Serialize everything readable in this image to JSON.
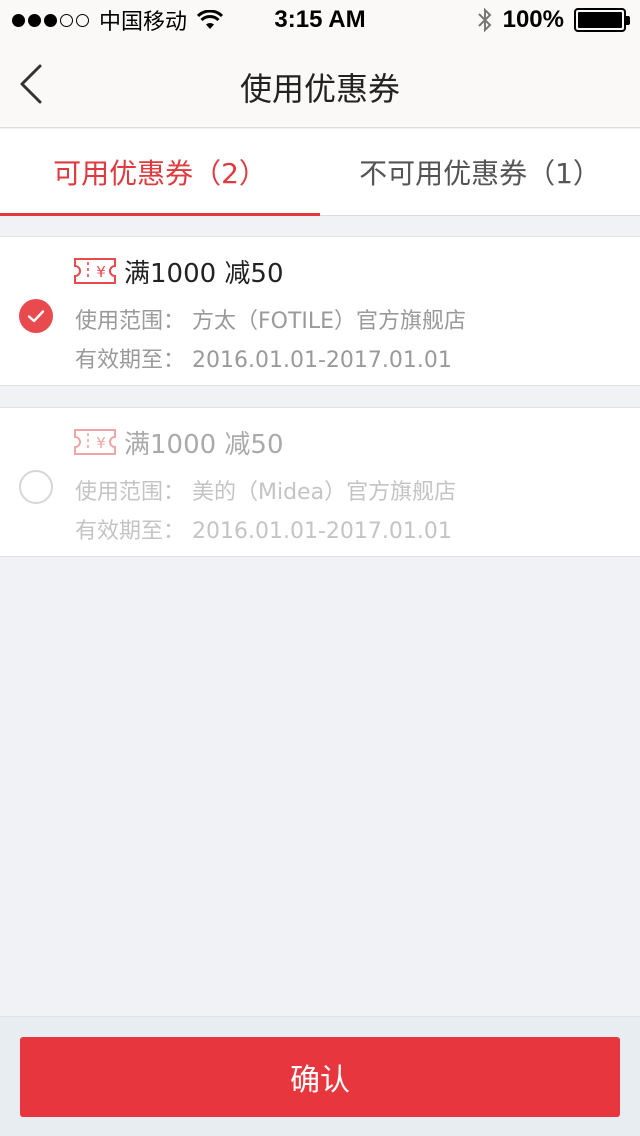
{
  "status_bar": {
    "carrier": "中国移动",
    "time": "3:15 AM",
    "battery": "100%"
  },
  "nav": {
    "title": "使用优惠券",
    "back_icon": "chevron-left-icon"
  },
  "tabs": [
    {
      "label": "可用优惠券（2）",
      "active": true
    },
    {
      "label": "不可用优惠券（1）",
      "active": false
    }
  ],
  "coupons": [
    {
      "title": "满1000 减50",
      "scope": "使用范围：  方太（FOTILE）官方旗舰店",
      "validity": "有效期至：  2016.01.01-2017.01.01",
      "selected": true
    },
    {
      "title": "满1000 减50",
      "scope": "使用范围：  美的（Midea）官方旗舰店",
      "validity": "有效期至：  2016.01.01-2017.01.01",
      "selected": false
    }
  ],
  "confirm_label": "确认",
  "colors": {
    "accent": "#e7363d",
    "tab_active": "#e0393e",
    "page_bg": "#f0f2f5"
  }
}
